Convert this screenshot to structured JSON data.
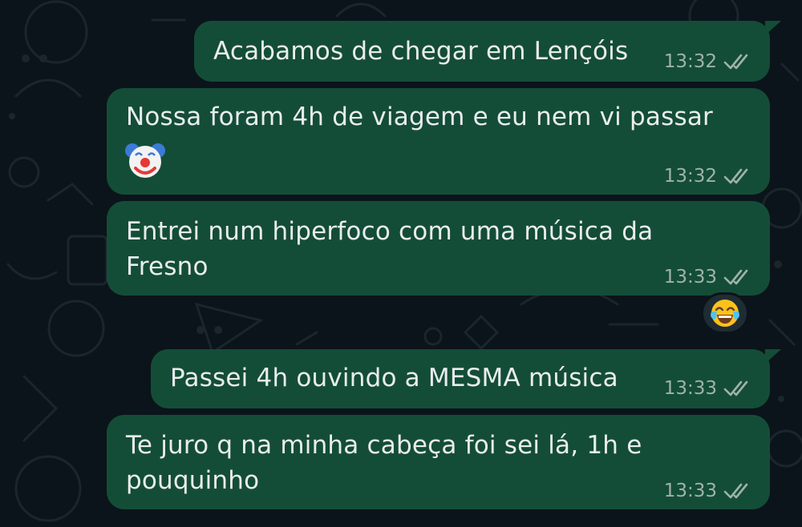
{
  "chat": {
    "messages": [
      {
        "text": "Acabamos de chegar em Lençóis",
        "time": "13:32",
        "status": "read"
      },
      {
        "text": "Nossa foram 4h de viagem e eu nem vi passar",
        "emoji": "clown-face",
        "time": "13:32",
        "status": "read"
      },
      {
        "text": "Entrei num hiperfoco com uma música da\nFresno",
        "time": "13:33",
        "status": "read",
        "reaction": "face-with-tears-of-joy"
      },
      {
        "text": "Passei 4h ouvindo a MESMA música",
        "time": "13:33",
        "status": "read"
      },
      {
        "text": "Te juro q na minha cabeça foi sei lá, 1h e\npouquinho",
        "time": "13:33",
        "status": "read"
      }
    ]
  },
  "colors": {
    "background": "#0b141a",
    "outgoing_bubble": "#144d37",
    "text": "#e9edef",
    "meta": "#9fb3a9",
    "read_ticks": "#9fb3a9"
  }
}
